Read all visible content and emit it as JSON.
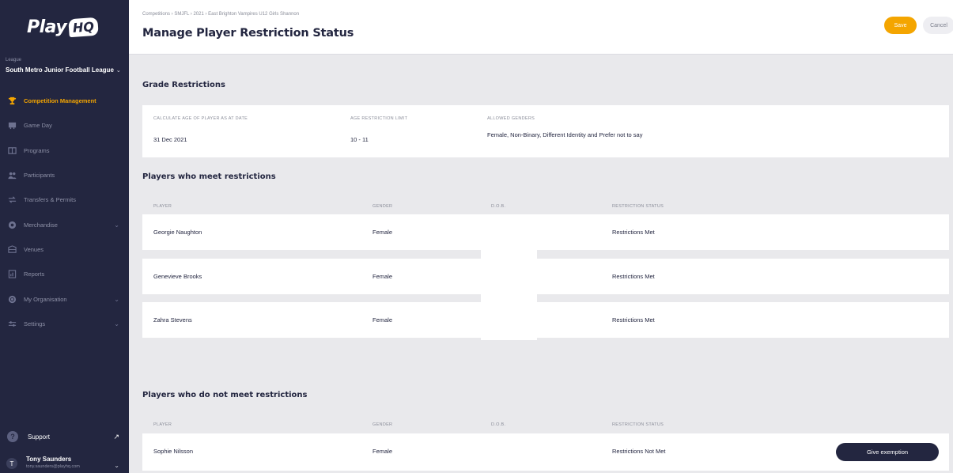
{
  "sidebar": {
    "logo_text": "Play",
    "logo_badge": "HQ",
    "league_label": "League",
    "league_name": "South Metro Junior Football League",
    "items": [
      {
        "label": "Competition Management",
        "icon": "trophy-icon",
        "active": true,
        "chevron": false
      },
      {
        "label": "Game Day",
        "icon": "scoreboard-icon",
        "active": false,
        "chevron": false
      },
      {
        "label": "Programs",
        "icon": "programs-icon",
        "active": false,
        "chevron": false
      },
      {
        "label": "Participants",
        "icon": "participants-icon",
        "active": false,
        "chevron": false
      },
      {
        "label": "Transfers & Permits",
        "icon": "transfer-icon",
        "active": false,
        "chevron": false
      },
      {
        "label": "Merchandise",
        "icon": "merchandise-icon",
        "active": false,
        "chevron": true
      },
      {
        "label": "Venues",
        "icon": "venues-icon",
        "active": false,
        "chevron": false
      },
      {
        "label": "Reports",
        "icon": "reports-icon",
        "active": false,
        "chevron": false
      },
      {
        "label": "My Organisation",
        "icon": "organisation-icon",
        "active": false,
        "chevron": true
      },
      {
        "label": "Settings",
        "icon": "settings-icon",
        "active": false,
        "chevron": true
      }
    ],
    "support_label": "Support",
    "user": {
      "initial": "T",
      "name": "Tony Saunders",
      "email": "tony.saunders@playhq.com"
    }
  },
  "header": {
    "breadcrumb": "Competitions  ›  SMJFL  ›  2021  ›  East Brighton Vampires U12 Girls Shannon",
    "title": "Manage Player Restriction Status",
    "save_label": "Save",
    "cancel_label": "Cancel"
  },
  "grade": {
    "title": "Grade Restrictions",
    "calc_label": "Calculate age of player as at date",
    "calc_value": "31 Dec 2021",
    "age_label": "Age restriction limit",
    "age_value": "10 - 11",
    "genders_label": "Allowed genders",
    "genders_value": "Female, Non-Binary, Different Identity and Prefer not to say"
  },
  "meet": {
    "title": "Players who meet restrictions",
    "headers": {
      "player": "Player",
      "gender": "Gender",
      "dob": "D.O.B.",
      "status": "Restriction status"
    },
    "rows": [
      {
        "player": "Georgie Naughton",
        "gender": "Female",
        "status": "Restrictions Met"
      },
      {
        "player": "Genevieve Brooks",
        "gender": "Female",
        "status": "Restrictions Met"
      },
      {
        "player": "Zahra Stevens",
        "gender": "Female",
        "status": "Restrictions Met"
      }
    ]
  },
  "notmeet": {
    "title": "Players who do not meet restrictions",
    "headers": {
      "player": "Player",
      "gender": "Gender",
      "dob": "D.O.B.",
      "status": "Restriction status"
    },
    "rows": [
      {
        "player": "Sophie Nilsson",
        "gender": "Female",
        "status": "Restrictions Not Met",
        "action": "Give exemption"
      }
    ]
  }
}
